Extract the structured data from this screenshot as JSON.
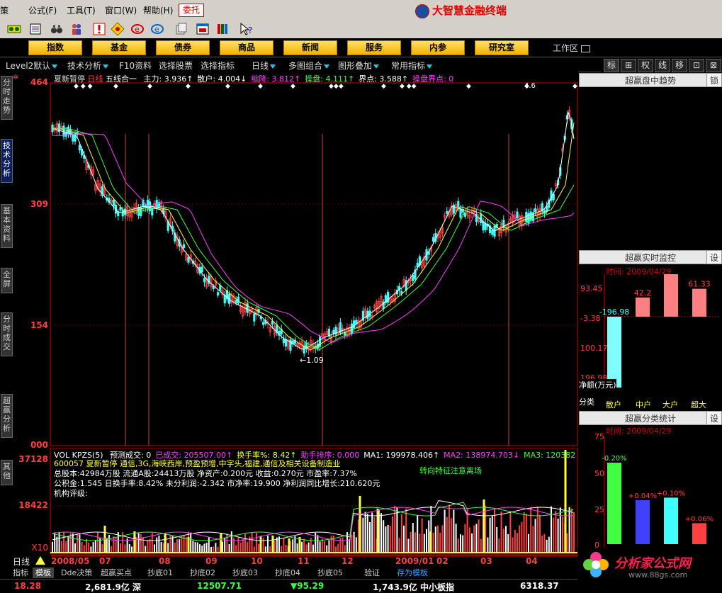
{
  "menu": [
    "策",
    "公式(F)",
    "工具(T)",
    "窗口(W)",
    "帮助(H)"
  ],
  "weituo": "委托",
  "brand": "大智慧金融终端",
  "nav_buttons": [
    "指数",
    "基金",
    "债券",
    "商品",
    "新闻",
    "服务",
    "内参",
    "研究室"
  ],
  "workarea": "工作区",
  "subbar": [
    "Level2默认",
    "技术分析",
    "F10资料",
    "选择股票",
    "选择指标",
    "日线",
    "多图组合",
    "图形叠加",
    "常用指标"
  ],
  "right_tabs": [
    "标",
    "⊞",
    "权",
    "线",
    "移",
    "⊡",
    "⊠"
  ],
  "left_tabs": [
    "分时走势",
    "技术分析",
    "基本资料",
    "全屏",
    "分时成交",
    "超赢分析",
    "其他"
  ],
  "main_legend": {
    "name": "夏新暂停",
    "period": "日线",
    "mode": "五线合一",
    "items": [
      {
        "label": "主力:",
        "value": "3.936↑",
        "color": "#ffffff"
      },
      {
        "label": "散户:",
        "value": "4.004↓",
        "color": "#ffffff"
      },
      {
        "label": "缩降:",
        "value": "3.812↑",
        "color": "#ff40ff"
      },
      {
        "label": "操盘:",
        "value": "4.111↑",
        "color": "#40ff40"
      },
      {
        "label": "界点:",
        "value": "3.588↑",
        "color": "#ffffff"
      },
      {
        "label": "操盘界点:",
        "value": "0",
        "color": "#ff40ff"
      }
    ]
  },
  "price_axis": [
    "464",
    "309",
    "154",
    "000"
  ],
  "low_label": "←1.09",
  "high_label": "4.6",
  "vol_axis": [
    "37128",
    "18422",
    "X10"
  ],
  "vol_legend": {
    "prefix": "VOL KPZS(5)",
    "items": [
      {
        "label": "预测成交:",
        "value": "0",
        "color": "#ffffff"
      },
      {
        "label": "已成交:",
        "value": "205507.00↑",
        "color": "#ff40ff"
      },
      {
        "label": "换手率%:",
        "value": "8.42↑",
        "color": "#ffff40"
      },
      {
        "label": "助手排序:",
        "value": "0.000",
        "color": "#ff40ff"
      },
      {
        "label": "MA1:",
        "value": "199978.406↑",
        "color": "#ffffff"
      },
      {
        "label": "MA2:",
        "value": "138974.703↓",
        "color": "#ff40ff"
      },
      {
        "label": "MA3:",
        "value": "120382",
        "color": "#40ff40"
      }
    ]
  },
  "info_box": {
    "line1": "600057 夏新暂停 通信,3G,海峡西岸,预盈预增,中字头,福建,通信及相关设备制造业",
    "line2": "总股本:42984万股 流通A股:24413万股 净资产:0.200元 收益:0.270元 市盈率:7.37%",
    "line3": "公积金:1.545 日换手率:8.42% 未分利润:-2.342 市净率:19.900 净利润同比增长:210.620元",
    "line4": "机构评级:",
    "signal": "转向特征注意离场"
  },
  "date_axis": [
    "2008/05",
    "07",
    "08",
    "09",
    "10",
    "11",
    "12",
    "2009/01",
    "02",
    "03",
    "04"
  ],
  "period_label": "日线",
  "bottom_tabs": [
    "指标",
    "模板",
    "Dde决策",
    "超赢买点",
    "抄底01",
    "抄底02",
    "抄底03",
    "抄底04",
    "抄底05",
    "验证",
    "存为模板"
  ],
  "status": [
    {
      "text": "18.28",
      "color": "#ff4040"
    },
    {
      "text": "2,681.9亿 深",
      "color": "#ffffff"
    },
    {
      "text": "12507.71",
      "color": "#40ff40"
    },
    {
      "text": "▼95.29",
      "color": "#40ff40"
    },
    {
      "text": "1,743.9亿 中小板指",
      "color": "#ffffff"
    },
    {
      "text": "6318.37",
      "color": "#ffffff"
    }
  ],
  "trend_panel": {
    "title": "超赢盘中趋势",
    "lock": "锁"
  },
  "monitor_panel": {
    "title": "超赢实时监控",
    "side": "设",
    "time": "时间: 2009/04/29",
    "y_labels": [
      "93.45",
      "-3.38",
      "100.17",
      "196.98"
    ],
    "ylabel": "净额(万元)",
    "category_label": "分类",
    "chart_data": {
      "type": "bar",
      "categories": [
        "散户",
        "中户",
        "大户",
        "超大"
      ],
      "values": [
        -196.98,
        42.2,
        93.45,
        61.33
      ],
      "value_labels": [
        "-196.98",
        "42.2",
        "93.45",
        "61.33"
      ],
      "ylabel": "净额(万元)",
      "ylim": [
        -196.98,
        93.45
      ]
    }
  },
  "stats_panel": {
    "title": "超赢分类统计",
    "side": "设",
    "time": "时间: 2009/04/29",
    "y_labels": [
      "75",
      "50",
      "25",
      "0"
    ],
    "chart_data": {
      "type": "bar",
      "categories": [
        "散户",
        "中户",
        "大户",
        "超大"
      ],
      "values": [
        -0.2,
        0.04,
        0.1,
        0.06
      ],
      "heights": [
        57.5,
        31.1,
        32.8,
        14.8
      ],
      "value_labels": [
        "-0.20%",
        "+0.04%",
        "+0.10%",
        "+0.06%"
      ],
      "ylim": [
        0,
        75
      ]
    }
  },
  "watermark": {
    "text": "分析家公式网",
    "url": "www.88gs.com"
  },
  "colors": {
    "up": "#ff4040",
    "down": "#40ffff",
    "ma5": "#ffffff",
    "ma10": "#ffff40",
    "ma20": "#40ff40",
    "ma60": "#ff40ff"
  }
}
